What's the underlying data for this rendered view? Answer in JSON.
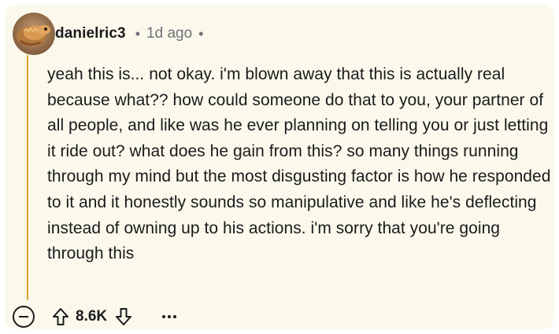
{
  "comment": {
    "author": "danielric3",
    "separator": "•",
    "time": "1d ago",
    "trailing_separator": "•",
    "avatar_icon": "bearded-dragon-avatar",
    "body": "yeah this is... not okay. i'm blown away that this is actually real because what?? how could someone do that to you, your partner of all people, and like was he ever planning on telling you or just letting it ride out? what does he gain from this? so many things running through my mind but the most disgusting factor is how he responded to it and it honestly sounds so manipulative and like he's deflecting instead of owning up to his actions. i'm sorry that you're going through this"
  },
  "actions": {
    "collapse_icon": "minus-circle-icon",
    "upvote_icon": "arrow-up-icon",
    "score": "8.6K",
    "downvote_icon": "arrow-down-icon",
    "more_icon": "more-horizontal-icon"
  },
  "colors": {
    "card_background": "#fbf9ec",
    "thread_line": "#e5a12a",
    "text": "#1a1a1b",
    "meta_text": "#6e7275"
  }
}
